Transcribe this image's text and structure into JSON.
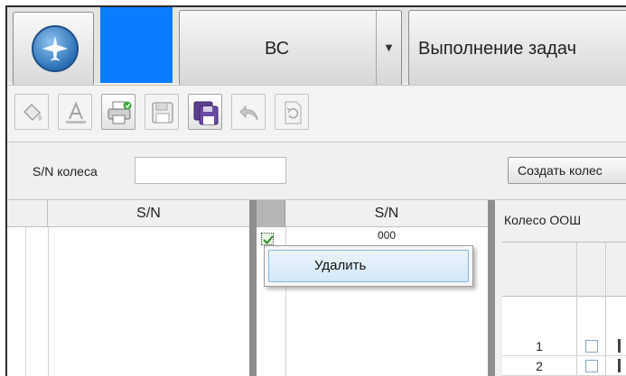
{
  "header": {
    "combo_value": "ВС",
    "task_button_label": "Выполнение задач",
    "brand_color": "#0a7cff"
  },
  "toolbar": {
    "buttons": [
      "paint-bucket-icon",
      "text-format-icon",
      "print-icon",
      "save-icon",
      "save-all-icon",
      "undo-icon",
      "refresh-document-icon"
    ]
  },
  "filter": {
    "sn_label": "S/N колеса",
    "sn_value": "",
    "create_button_label": "Создать колес"
  },
  "left_grid": {
    "columns": [
      "S/N"
    ]
  },
  "middle_grid": {
    "columns": [
      "S/N"
    ],
    "rows": [
      {
        "checked": true,
        "sn": "000"
      }
    ]
  },
  "context_menu": {
    "items": [
      "Удалить"
    ]
  },
  "right_panel": {
    "title": "Колесо ООШ",
    "rows": [
      {
        "num": "1"
      },
      {
        "num": "2"
      }
    ]
  }
}
